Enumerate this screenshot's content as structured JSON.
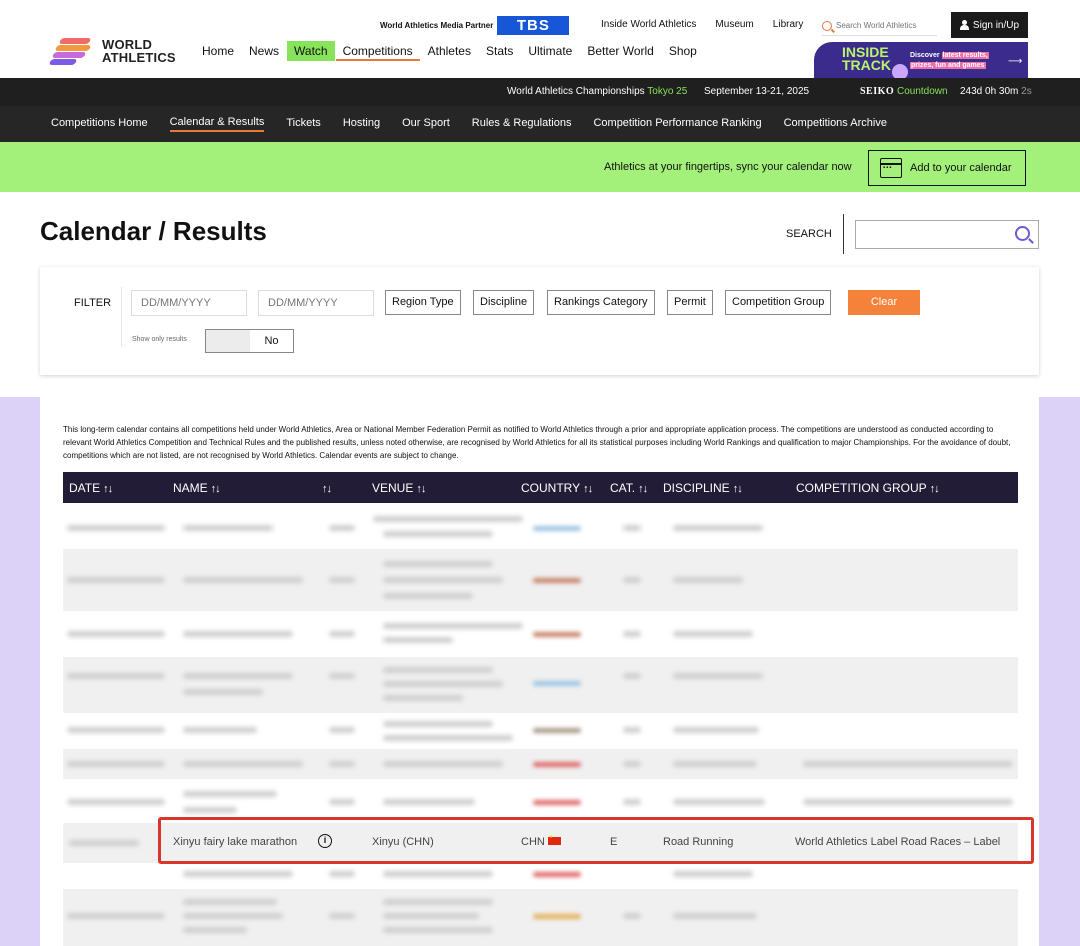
{
  "header": {
    "logo": {
      "line1": "WORLD",
      "line2": "ATHLETICS"
    },
    "main_nav": [
      {
        "label": "Home"
      },
      {
        "label": "News"
      },
      {
        "label": "Watch"
      },
      {
        "label": "Competitions"
      },
      {
        "label": "Athletes"
      },
      {
        "label": "Stats"
      },
      {
        "label": "Ultimate"
      },
      {
        "label": "Better World"
      },
      {
        "label": "Shop"
      }
    ],
    "partner_label": "World Athletics Media Partner",
    "partner_name": "TBS",
    "util_nav": [
      {
        "label": "Inside World Athletics"
      },
      {
        "label": "Museum"
      },
      {
        "label": "Library"
      }
    ],
    "search_placeholder": "Search World Athletics",
    "signin_label": "Sign in/Up",
    "inside_track": {
      "title_line1": "INSIDE",
      "title_line2": "TRACK",
      "text_line1_a": "Discover ",
      "text_line1_b": "latest results,",
      "text_line2": "prizes, fun and games"
    }
  },
  "championship_bar": {
    "event": "World Athletics Championships",
    "city": "Tokyo 25",
    "dates": "September 13-21, 2025",
    "sponsor": "SEIKO",
    "countdown_label": "Countdown",
    "timer": "243d 0h 30m",
    "timer_seconds": "2s"
  },
  "sub_nav": [
    {
      "label": "Competitions Home"
    },
    {
      "label": "Calendar & Results"
    },
    {
      "label": "Tickets"
    },
    {
      "label": "Hosting"
    },
    {
      "label": "Our Sport"
    },
    {
      "label": "Rules & Regulations"
    },
    {
      "label": "Competition Performance Ranking"
    },
    {
      "label": "Competitions Archive"
    }
  ],
  "banner": {
    "text": "Athletics at your fingertips, sync your calendar now",
    "button_label": "Add to your calendar"
  },
  "page": {
    "title": "Calendar / Results",
    "search_label": "SEARCH",
    "search_value": ""
  },
  "filter": {
    "label": "FILTER",
    "date_from_placeholder": "DD/MM/YYYY",
    "date_to_placeholder": "DD/MM/YYYY",
    "buttons": [
      {
        "label": "Region Type"
      },
      {
        "label": "Discipline"
      },
      {
        "label": "Rankings Category"
      },
      {
        "label": "Permit"
      },
      {
        "label": "Competition Group"
      }
    ],
    "clear_label": "Clear",
    "show_only_label": "Show only results",
    "show_only_value": "No"
  },
  "table": {
    "disclaimer": "This long-term calendar contains all competitions held under World Athletics, Area or National Member Federation Permit as notified to World Athletics through a prior and appropriate application process. The competitions are understood as conducted according to relevant World Athletics Competition and Technical Rules and the published results, unless noted otherwise, are recognised by World Athletics for all its statistical purposes including World Rankings and qualification to major Championships. For the avoidance of doubt, competitions which are not listed, are not recognised by World Athletics. Calendar events are subject to change.",
    "columns": [
      {
        "label": "DATE"
      },
      {
        "label": "NAME"
      },
      {
        "label": ""
      },
      {
        "label": "VENUE"
      },
      {
        "label": "COUNTRY"
      },
      {
        "label": "CAT."
      },
      {
        "label": "DISCIPLINE"
      },
      {
        "label": "COMPETITION GROUP"
      }
    ],
    "highlighted_row": {
      "name": "Xinyu fairy lake marathon",
      "venue": "Xinyu (CHN)",
      "country": "CHN",
      "category": "E",
      "discipline": "Road Running",
      "competition_group": "World Athletics Label Road Races – Label"
    }
  },
  "colors": {
    "accent_orange": "#f5823a",
    "watch_green": "#86e35a",
    "banner_green": "#a3f07a",
    "table_header": "#231c36",
    "page_purple": "#dcd1f7",
    "highlight_red": "#d9362b"
  }
}
